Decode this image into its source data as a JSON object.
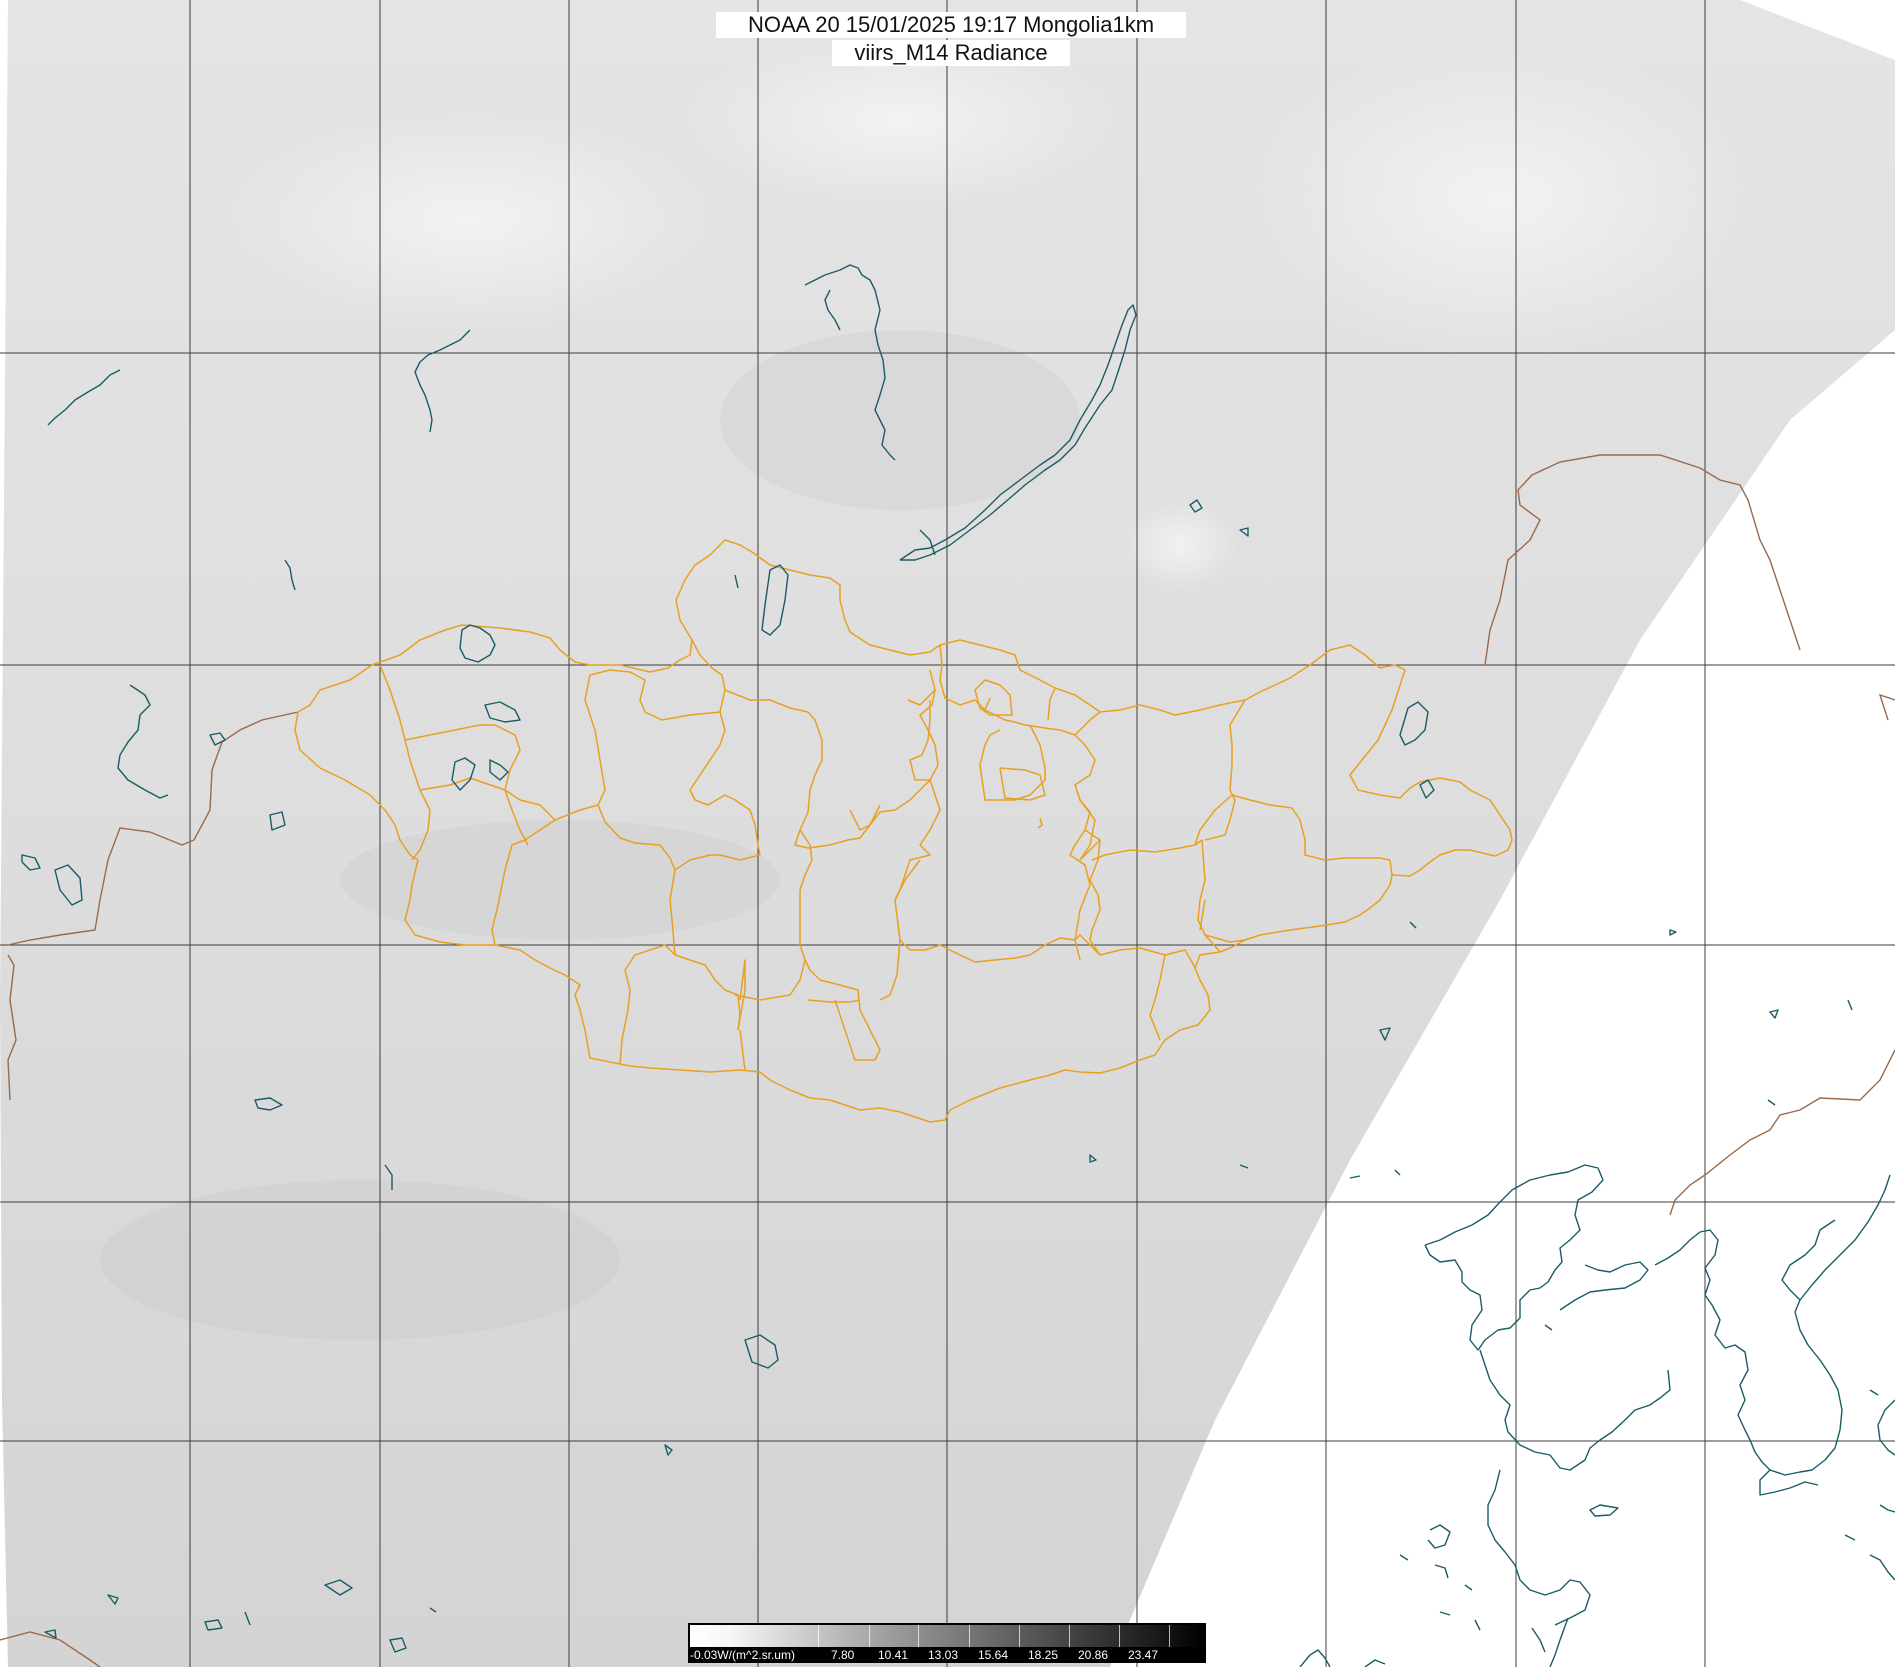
{
  "title": {
    "line1": "NOAA 20 15/01/2025 19:17 Mongolia1km",
    "line2": "viirs_M14 Radiance"
  },
  "colorbar": {
    "unit_label": "-0.03W/(m^2.sr.um)",
    "tick_labels": [
      "7.80",
      "10.41",
      "13.03",
      "15.64",
      "18.25",
      "20.86",
      "23.47"
    ]
  },
  "colors": {
    "background_no_data": "#ffffff",
    "imagery_base": "#dcdcdc",
    "grid_lines": "#3c3c3c",
    "mongolia_borders": "#e8a020",
    "international_borders": "#9a6a4a",
    "coastlines_lakes": "#1a5c66"
  },
  "layers": {
    "imagery": "satellite-radiance-grayscale",
    "grid": "lat-lon-graticule",
    "borders": "mongolia-aimag-boundaries",
    "coast": "coastlines-and-lakes"
  }
}
